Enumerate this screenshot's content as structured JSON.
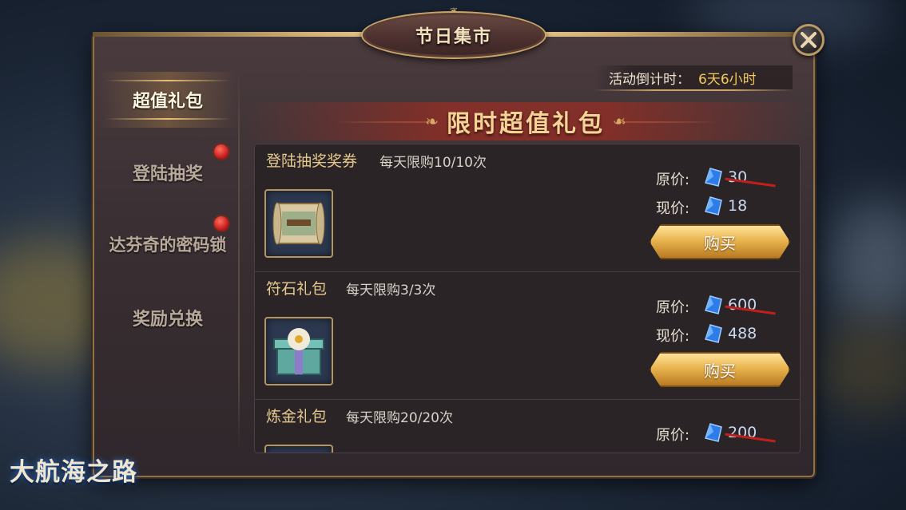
{
  "window": {
    "title": "节日集市",
    "countdown_label": "活动倒计时：",
    "countdown_value": "6天6小时"
  },
  "sidebar": {
    "items": [
      {
        "label": "超值礼包",
        "active": true,
        "badge": false
      },
      {
        "label": "登陆抽奖",
        "active": false,
        "badge": true
      },
      {
        "label": "达芬奇的密码锁",
        "active": false,
        "badge": true
      },
      {
        "label": "奖励兑换",
        "active": false,
        "badge": false
      }
    ]
  },
  "banner": {
    "title": "限时超值礼包"
  },
  "packs": [
    {
      "name": "登陆抽奖奖券",
      "limit": "每天限购10/10次",
      "original_label": "原价:",
      "original_price": "30",
      "current_label": "现价:",
      "current_price": "18",
      "buy_label": "购买",
      "icon": "scroll-ticket-icon"
    },
    {
      "name": "符石礼包",
      "limit": "每天限购3/3次",
      "original_label": "原价:",
      "original_price": "600",
      "current_label": "现价:",
      "current_price": "488",
      "buy_label": "购买",
      "icon": "gift-box-icon"
    },
    {
      "name": "炼金礼包",
      "limit": "每天限购20/20次",
      "original_label": "原价:",
      "original_price": "200",
      "icon": "alchemy-pack-icon"
    }
  ],
  "logo": {
    "text": "大航海之路"
  },
  "colors": {
    "gold_text": "#e6c98c",
    "countdown_value": "#f3c95a",
    "badge_red": "#c0141a",
    "gem_blue": "#2f7be8"
  }
}
